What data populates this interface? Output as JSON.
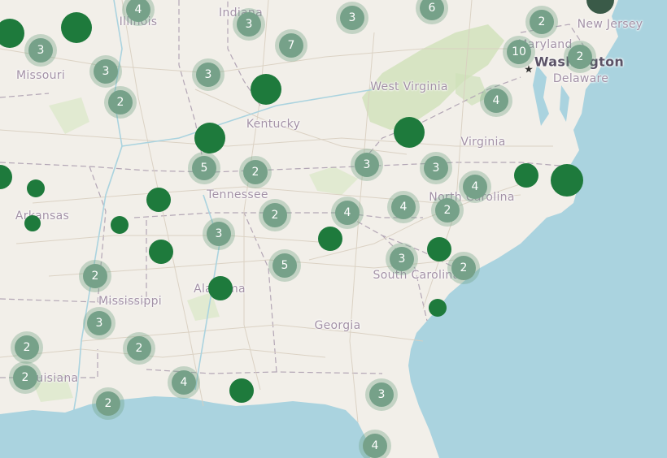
{
  "map": {
    "colors": {
      "land": "#f2efe9",
      "water": "#aad3df",
      "cluster_fill": "#76a189",
      "cluster_halo": "rgba(110,160,130,0.35)",
      "marker": "#1e7a3c",
      "label": "#a391a6"
    },
    "labels": [
      {
        "text": "Illinois",
        "cls": "state"
      },
      {
        "text": "Indiana",
        "cls": "state"
      },
      {
        "text": "Missouri",
        "cls": "state"
      },
      {
        "text": "Kentucky",
        "cls": "state"
      },
      {
        "text": "West Virginia",
        "cls": "state"
      },
      {
        "text": "Virginia",
        "cls": "state"
      },
      {
        "text": "Tennessee",
        "cls": "state"
      },
      {
        "text": "North Carolina",
        "cls": "state"
      },
      {
        "text": "Arkansas",
        "cls": "state"
      },
      {
        "text": "South Carolina",
        "cls": "state"
      },
      {
        "text": "Mississippi",
        "cls": "state"
      },
      {
        "text": "Alabama",
        "cls": "state"
      },
      {
        "text": "Georgia",
        "cls": "state"
      },
      {
        "text": "Louisiana",
        "cls": "state"
      },
      {
        "text": "New Jersey",
        "cls": "state"
      },
      {
        "text": "Maryland",
        "cls": "state"
      },
      {
        "text": "Delaware",
        "cls": "state"
      },
      {
        "text": "Washington",
        "cls": "city"
      }
    ],
    "clusters": [
      {
        "count": "4"
      },
      {
        "count": "3"
      },
      {
        "count": "3"
      },
      {
        "count": "6"
      },
      {
        "count": "2"
      },
      {
        "count": "3"
      },
      {
        "count": "7"
      },
      {
        "count": "10"
      },
      {
        "count": "2"
      },
      {
        "count": "3"
      },
      {
        "count": "3"
      },
      {
        "count": "2"
      },
      {
        "count": "4"
      },
      {
        "count": "5"
      },
      {
        "count": "2"
      },
      {
        "count": "3"
      },
      {
        "count": "3"
      },
      {
        "count": "4"
      },
      {
        "count": "4"
      },
      {
        "count": "4"
      },
      {
        "count": "2"
      },
      {
        "count": "2"
      },
      {
        "count": "3"
      },
      {
        "count": "5"
      },
      {
        "count": "3"
      },
      {
        "count": "2"
      },
      {
        "count": "2"
      },
      {
        "count": "3"
      },
      {
        "count": "2"
      },
      {
        "count": "2"
      },
      {
        "count": "2"
      },
      {
        "count": "4"
      },
      {
        "count": "2"
      },
      {
        "count": "3"
      },
      {
        "count": "4"
      }
    ],
    "markers": 18
  }
}
